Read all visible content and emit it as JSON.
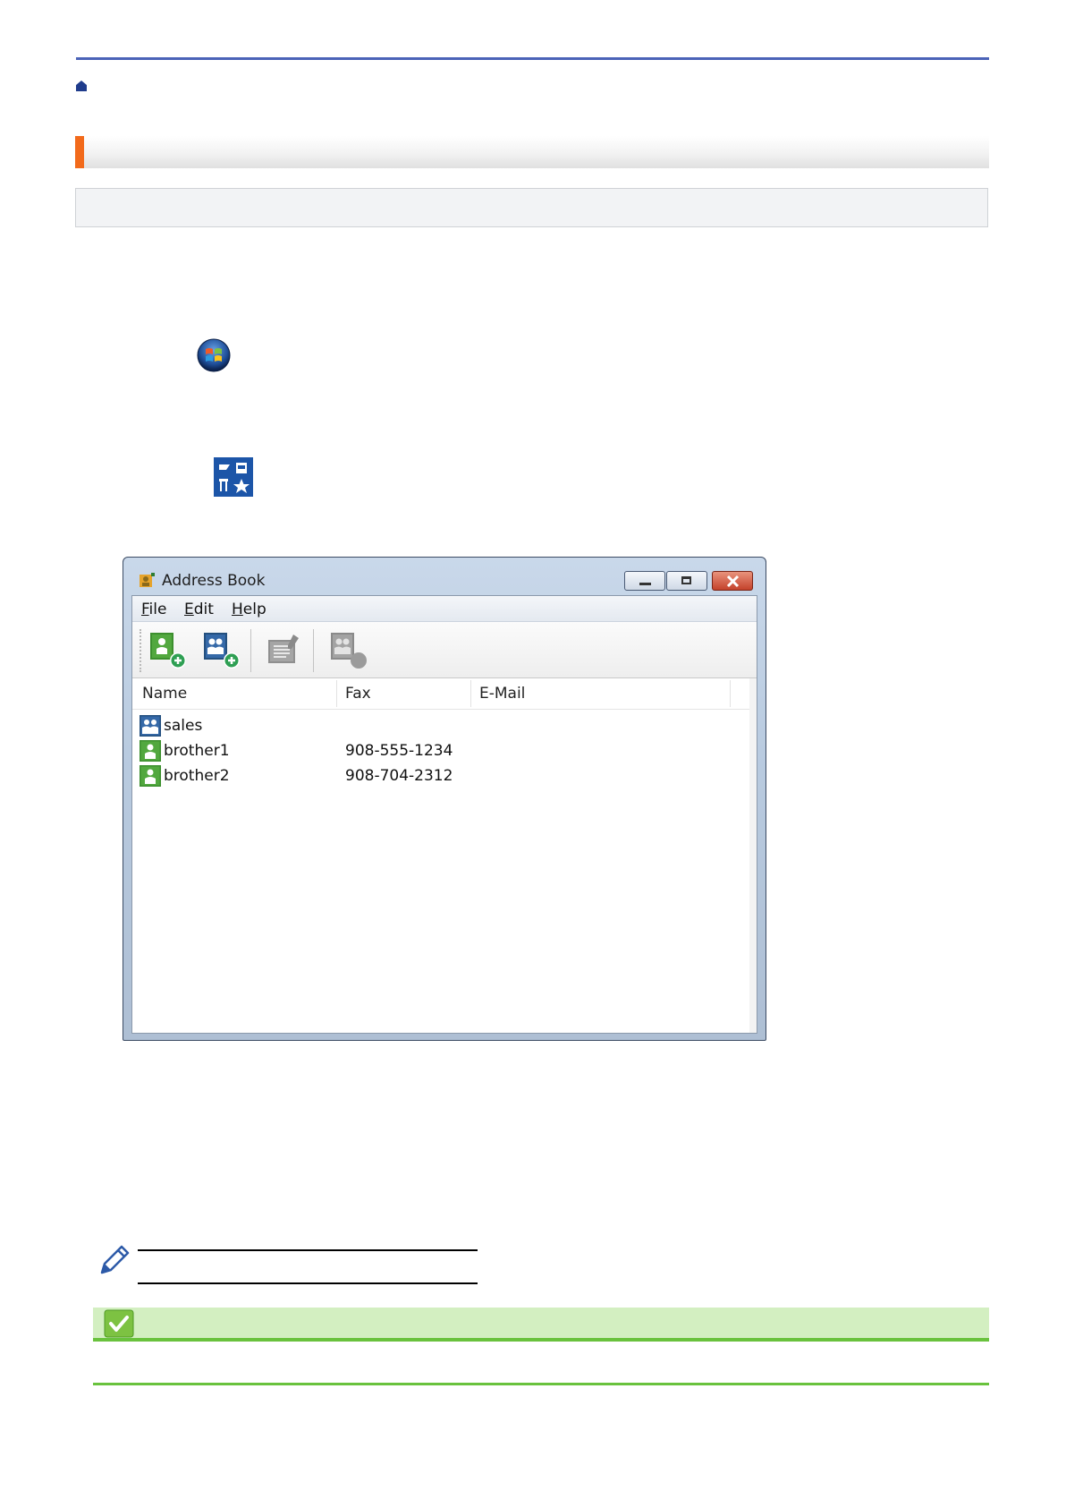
{
  "window": {
    "title": "Address Book",
    "menu": {
      "file_accel": "F",
      "file_rest": "ile",
      "edit_accel": "E",
      "edit_rest": "dit",
      "help_accel": "H",
      "help_rest": "elp"
    },
    "toolbar_icons": [
      "add-contact-icon",
      "add-group-icon",
      "edit-icon",
      "delete-icon"
    ],
    "columns": {
      "name": "Name",
      "fax": "Fax",
      "email": "E-Mail"
    },
    "rows": [
      {
        "name": "sales",
        "fax": "",
        "email": "",
        "type": "group"
      },
      {
        "name": "brother1",
        "fax": "908-555-1234",
        "email": "",
        "type": "contact"
      },
      {
        "name": "brother2",
        "fax": "908-704-2312",
        "email": "",
        "type": "contact"
      }
    ]
  },
  "colors": {
    "rule_blue": "#4b63b8",
    "accent_orange": "#f26a1b",
    "related_green": "#69c23d",
    "related_bg": "#d3efc1"
  }
}
